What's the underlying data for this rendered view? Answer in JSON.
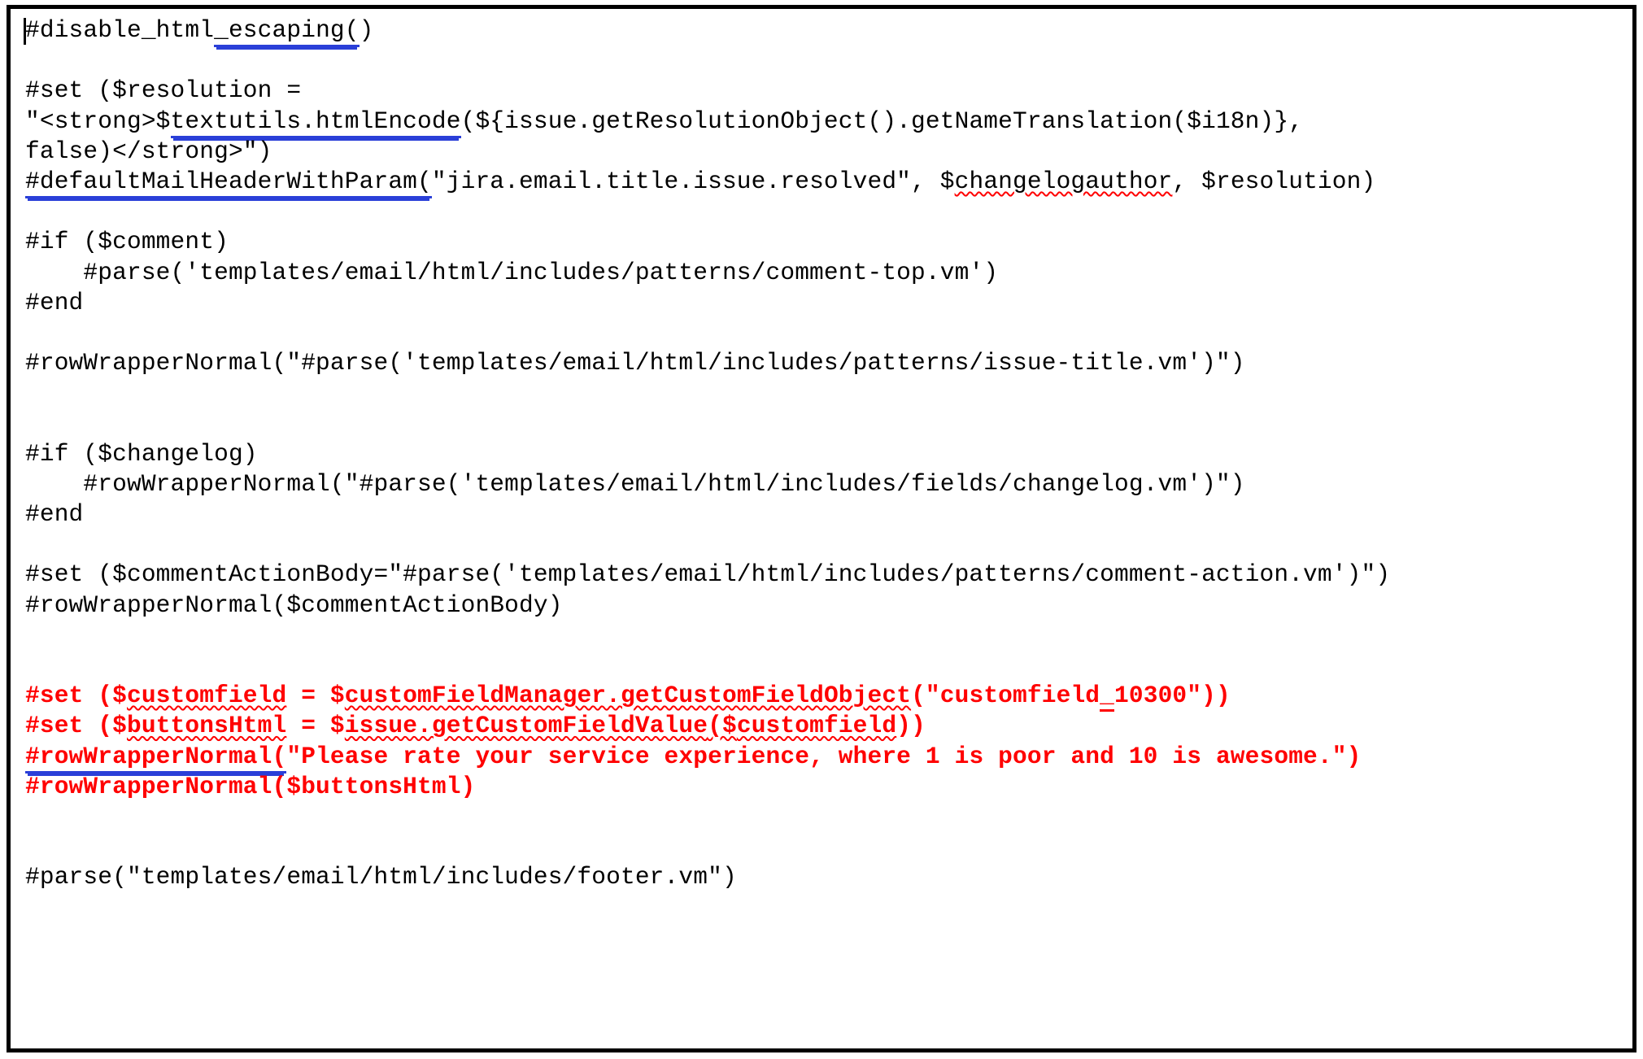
{
  "document": {
    "kind": "code-listing",
    "language": "Velocity template (Jira email template)",
    "colors": {
      "text": "#000000",
      "highlight": "#ff0000",
      "link_underline": "#2a3fd8",
      "spellcheck_underline": "#ff0000",
      "background": "#ffffff",
      "border": "#000000"
    }
  },
  "code": {
    "lines": [
      {
        "id": "l1",
        "segments": [
          {
            "text": "#disable_html",
            "style": "plain"
          },
          {
            "text": "_escaping(",
            "style": "dbl-blue"
          },
          {
            "text": ")",
            "style": "plain"
          }
        ]
      },
      {
        "id": "l2",
        "segments": [
          {
            "text": "",
            "style": "blank"
          }
        ]
      },
      {
        "id": "l3",
        "segments": [
          {
            "text": "#set ($resolution =",
            "style": "plain"
          }
        ]
      },
      {
        "id": "l4",
        "segments": [
          {
            "text": "\"<strong>$",
            "style": "plain"
          },
          {
            "text": "textutils.htmlEncode",
            "style": "dbl-blue"
          },
          {
            "text": "(${issue.getResolutionObject().getNameTranslation($i18n)},",
            "style": "plain"
          }
        ]
      },
      {
        "id": "l5",
        "segments": [
          {
            "text": "false)</strong>\")",
            "style": "plain"
          }
        ]
      },
      {
        "id": "l6",
        "segments": [
          {
            "text": "#defaultMailHeaderWithParam(",
            "style": "dbl-blue"
          },
          {
            "text": "\"jira.email.title.issue.resolved\", $",
            "style": "plain"
          },
          {
            "text": "changelogauthor",
            "style": "wavy-red"
          },
          {
            "text": ", $resolution)",
            "style": "plain"
          }
        ]
      },
      {
        "id": "l7",
        "segments": [
          {
            "text": "",
            "style": "blank"
          }
        ]
      },
      {
        "id": "l8",
        "segments": [
          {
            "text": "#if ($comment)",
            "style": "plain"
          }
        ]
      },
      {
        "id": "l9",
        "segments": [
          {
            "text": "    #parse('templates/email/html/includes/patterns/comment-top.vm')",
            "style": "plain"
          }
        ]
      },
      {
        "id": "l10",
        "segments": [
          {
            "text": "#end",
            "style": "plain"
          }
        ]
      },
      {
        "id": "l11",
        "segments": [
          {
            "text": "",
            "style": "blank"
          }
        ]
      },
      {
        "id": "l12",
        "segments": [
          {
            "text": "#rowWrapperNormal(\"#parse('templates/email/html/includes/patterns/issue-title.vm')\")",
            "style": "plain"
          }
        ]
      },
      {
        "id": "l13",
        "segments": [
          {
            "text": "",
            "style": "blank"
          }
        ]
      },
      {
        "id": "l14",
        "segments": [
          {
            "text": "",
            "style": "blank"
          }
        ]
      },
      {
        "id": "l15",
        "segments": [
          {
            "text": "#if ($changelog)",
            "style": "plain"
          }
        ]
      },
      {
        "id": "l16",
        "segments": [
          {
            "text": "    #rowWrapperNormal(\"#parse('templates/email/html/includes/fields/changelog.vm')\")",
            "style": "plain"
          }
        ]
      },
      {
        "id": "l17",
        "segments": [
          {
            "text": "#end",
            "style": "plain"
          }
        ]
      },
      {
        "id": "l18",
        "segments": [
          {
            "text": "",
            "style": "blank"
          }
        ]
      },
      {
        "id": "l19",
        "segments": [
          {
            "text": "#set ($commentActionBody=\"#parse('templates/email/html/includes/patterns/comment-action.vm')\")",
            "style": "plain"
          }
        ]
      },
      {
        "id": "l20",
        "segments": [
          {
            "text": "#rowWrapperNormal($commentActionBody)",
            "style": "plain"
          }
        ]
      },
      {
        "id": "l21",
        "segments": [
          {
            "text": "",
            "style": "blank"
          }
        ]
      },
      {
        "id": "l22",
        "segments": [
          {
            "text": "",
            "style": "blank"
          }
        ]
      },
      {
        "id": "l23",
        "red": true,
        "segments": [
          {
            "text": "#set ($",
            "style": "plain"
          },
          {
            "text": "customfield",
            "style": "wavy-red"
          },
          {
            "text": " = $",
            "style": "plain"
          },
          {
            "text": "customFieldManager.getCustomFieldObject",
            "style": "wavy-red"
          },
          {
            "text": "(\"customfield",
            "style": "plain"
          },
          {
            "text": "_",
            "style": "solid-red-u"
          },
          {
            "text": "10300\"))",
            "style": "plain"
          }
        ]
      },
      {
        "id": "l24",
        "red": true,
        "segments": [
          {
            "text": "#set ($",
            "style": "plain"
          },
          {
            "text": "buttonsHtml",
            "style": "wavy-red"
          },
          {
            "text": " = $",
            "style": "plain"
          },
          {
            "text": "issue.getCustomFieldValue",
            "style": "wavy-red"
          },
          {
            "text": "($",
            "style": "wavy-red"
          },
          {
            "text": "customfield",
            "style": "wavy-red"
          },
          {
            "text": "))",
            "style": "plain"
          }
        ]
      },
      {
        "id": "l25",
        "red": true,
        "segments": [
          {
            "text": "#rowWrapperNormal(",
            "style": "dbl-blue-on-red"
          },
          {
            "text": "\"Please rate your service experience, where 1 is poor and 10 is awesome.\")",
            "style": "plain"
          }
        ]
      },
      {
        "id": "l26",
        "red": true,
        "segments": [
          {
            "text": "#rowWrapperNormal($buttonsHtml)",
            "style": "plain"
          }
        ]
      },
      {
        "id": "l27",
        "segments": [
          {
            "text": "",
            "style": "blank"
          }
        ]
      },
      {
        "id": "l28",
        "segments": [
          {
            "text": "",
            "style": "blank"
          }
        ]
      },
      {
        "id": "l29",
        "segments": [
          {
            "text": "#parse(\"templates/email/html/includes/footer.vm\")",
            "style": "plain"
          }
        ]
      }
    ]
  },
  "caret": {
    "visible": true,
    "line": "l1",
    "column": 0
  }
}
